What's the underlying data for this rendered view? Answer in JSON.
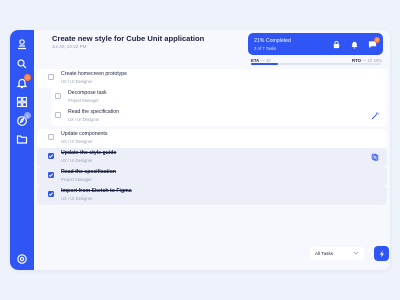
{
  "header": {
    "title": "Create new style for Cube Unit application",
    "date": "Jul 20, 10:22 PM"
  },
  "progress_card": {
    "completed_label": "21% Completed",
    "tasks_label": "3 of 7 Tasks",
    "icons": [
      "lock-icon",
      "bell-icon",
      "chat-icon"
    ],
    "chat_badge": "3",
    "percent": 21
  },
  "timing": {
    "eta_label": "ETA",
    "eta_value": "1h",
    "rto_label": "RTO",
    "rto_value": "1h 20m"
  },
  "sidebar": {
    "items": [
      {
        "name": "logo-icon"
      },
      {
        "name": "search-icon"
      },
      {
        "name": "bell-icon",
        "badge": "2",
        "badge_color": "#ff7d3d"
      },
      {
        "name": "grid-icon"
      },
      {
        "name": "compass-icon",
        "badge": "1",
        "badge_color": "#8aa3ff"
      },
      {
        "name": "folder-icon"
      },
      {
        "name": "settings-icon"
      }
    ]
  },
  "tasks": [
    {
      "name": "Create homecreen prototype",
      "role": "UX / UI Designer",
      "done": false,
      "indent": 0
    },
    {
      "name": "Decompose task",
      "role": "Project Manager",
      "done": false,
      "indent": 1
    },
    {
      "name": "Read the specification",
      "role": "UX / UI Designer",
      "done": false,
      "indent": 1,
      "icon": "magic-wand-icon"
    },
    {
      "name": "Update components",
      "role": "UX / UI Designer",
      "done": false,
      "indent": 0
    },
    {
      "name": "Update the style guide",
      "role": "UX / UI Designer",
      "done": true,
      "indent": 0,
      "icon": "attachment-icon"
    },
    {
      "name": "Read the specification",
      "role": "Project Manager",
      "done": true,
      "indent": 0
    },
    {
      "name": "Import from Sketch to Figma",
      "role": "UX / UI Designer",
      "done": true,
      "indent": 0
    }
  ],
  "filter": {
    "selected": "All Tasks"
  },
  "colors": {
    "accent": "#2f55f5",
    "badge_orange": "#ff7d3d",
    "text_dark": "#1c2140",
    "text_muted": "#9aa2b8"
  }
}
